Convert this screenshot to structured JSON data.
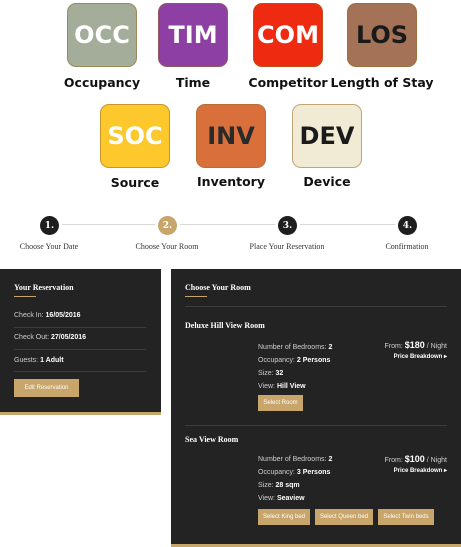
{
  "categories": [
    {
      "abbr": "OCC",
      "label": "Occupancy",
      "bg": "#a3ad99",
      "fg": "#ffffff"
    },
    {
      "abbr": "TIM",
      "label": "Time",
      "bg": "#8e3fa3",
      "fg": "#ffffff"
    },
    {
      "abbr": "COM",
      "label": "Competitor",
      "bg": "#ee2b10",
      "fg": "#ffffff"
    },
    {
      "abbr": "LOS",
      "label": "Length of Stay",
      "bg": "#a47256",
      "fg": "#1a1a1a"
    },
    {
      "abbr": "SOC",
      "label": "Source",
      "bg": "#fcc82c",
      "fg": "#ffffff"
    },
    {
      "abbr": "INV",
      "label": "Inventory",
      "bg": "#d9703c",
      "fg": "#2a2a2a"
    },
    {
      "abbr": "DEV",
      "label": "Device",
      "bg": "#f1ebd6",
      "fg": "#1a1a1a"
    }
  ],
  "steps": [
    {
      "num": "1.",
      "label": "Choose Your Date"
    },
    {
      "num": "2.",
      "label": "Choose Your Room"
    },
    {
      "num": "3.",
      "label": "Place Your Reservation"
    },
    {
      "num": "4.",
      "label": "Confirmation"
    }
  ],
  "reservation": {
    "title": "Your Reservation",
    "checkin_label": "Check In:",
    "checkin_value": "16/05/2016",
    "checkout_label": "Check Out:",
    "checkout_value": "27/05/2016",
    "guests_label": "Guests:",
    "guests_value": "1 Adult",
    "edit_button": "Edit Reservation"
  },
  "rooms_panel": {
    "title": "Choose Your Room",
    "rooms": [
      {
        "name": "Deluxe Hill View Room",
        "bedrooms_label": "Number of Bedrooms:",
        "bedrooms": "2",
        "occupancy_label": "Occupancy:",
        "occupancy": "2 Persons",
        "size_label": "Size:",
        "size": "32",
        "view_label": "View:",
        "view": "Hill View",
        "from_label": "From:",
        "price": "$180",
        "per": "/ Night",
        "breakdown": "Price Breakdown ▸",
        "buttons": [
          "Select Room"
        ]
      },
      {
        "name": "Sea View Room",
        "bedrooms_label": "Number of Bedrooms:",
        "bedrooms": "2",
        "occupancy_label": "Occupancy:",
        "occupancy": "3 Persons",
        "size_label": "Size:",
        "size": "28 sqm",
        "view_label": "View:",
        "view": "Seaview",
        "from_label": "From:",
        "price": "$100",
        "per": "/ Night",
        "breakdown": "Price Breakdown ▸",
        "buttons": [
          "Select King bed",
          "Select Queen bed",
          "Select Twin beds"
        ]
      }
    ]
  }
}
